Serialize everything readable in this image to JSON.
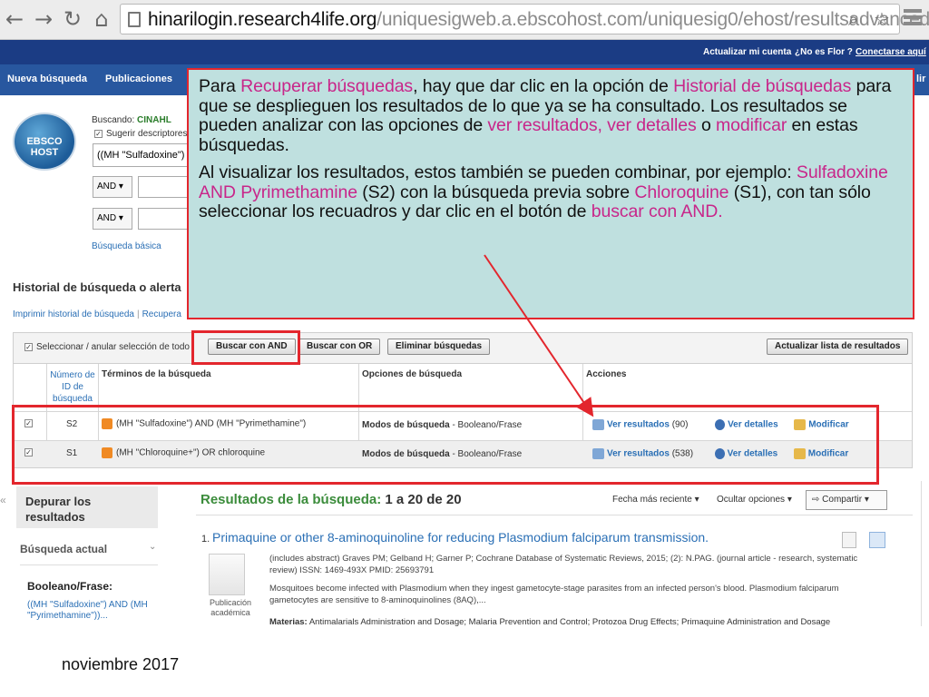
{
  "browser": {
    "url_host": "hinarilogin.research4life.org",
    "url_path": "/uniquesigweb.a.ebscohost.com/uniquesig0/ehost/resultsadvanced?..."
  },
  "topbar": {
    "update_account": "Actualizar mi cuenta",
    "not_user": "¿No es Flor ?",
    "login": "Conectarse aquí",
    "right_edge": "lir"
  },
  "navbar": {
    "new_search": "Nueva búsqueda",
    "publications": "Publicaciones"
  },
  "search": {
    "logo_text": "EBSCO HOST",
    "searching_label": "Buscando:",
    "database": "CINAHL",
    "suggest_label": "Sugerir descriptores",
    "query_value": "((MH \"Sulfadoxine\")",
    "bool_1": "AND",
    "bool_2": "AND",
    "basic_search": "Búsqueda básica"
  },
  "history": {
    "title": "Historial de búsqueda o alerta",
    "print_link": "Imprimir historial de búsqueda",
    "retrieve_link": "Recupera",
    "select_all": "Seleccionar / anular selección de todo",
    "btn_and": "Buscar con AND",
    "btn_or": "Buscar con OR",
    "btn_delete": "Eliminar búsquedas",
    "btn_refresh": "Actualizar lista de resultados",
    "col_id": "Número de ID de búsqueda",
    "col_terms": "Términos de la búsqueda",
    "col_options": "Opciones de búsqueda",
    "col_actions": "Acciones",
    "rows": [
      {
        "id": "S2",
        "terms": "(MH \"Sulfadoxine\") AND (MH \"Pyrimethamine\")",
        "mode_label": "Modos de búsqueda",
        "mode_value": "- Booleano/Frase",
        "view_results": "Ver resultados",
        "count": "(90)",
        "view_details": "Ver detalles",
        "modify": "Modificar"
      },
      {
        "id": "S1",
        "terms": "(MH \"Chloroquine+\") OR chloroquine",
        "mode_label": "Modos de búsqueda",
        "mode_value": "- Booleano/Frase",
        "view_results": "Ver resultados",
        "count": "(538)",
        "view_details": "Ver detalles",
        "modify": "Modificar"
      }
    ]
  },
  "sidebar": {
    "refine": "Depurar los resultados",
    "current_search": "Búsqueda actual",
    "bool_label": "Booleano/Frase:",
    "query": "((MH \"Sulfadoxine\") AND (MH \"Pyrimethamine\"))..."
  },
  "results": {
    "title": "Resultados de la búsqueda:",
    "range": "1 a 20 de 20",
    "sort": "Fecha más reciente",
    "hide_options": "Ocultar opciones",
    "share": "Compartir",
    "article": {
      "number": "1.",
      "title": "Primaquine or other 8-aminoquinoline for reducing Plasmodium falciparum transmission.",
      "meta": "(includes abstract) Graves PM; Gelband H; Garner P; Cochrane Database of Systematic Reviews, 2015; (2): N.PAG. (journal article - research, systematic review) ISSN: 1469-493X PMID: 25693791",
      "abstract": "Mosquitoes become infected with Plasmodium when they ingest gametocyte-stage parasites from an infected person's blood. Plasmodium falciparum gametocytes are sensitive to 8-aminoquinolines (8AQ),...",
      "subjects_label": "Materias:",
      "subjects": "Antimalarials Administration and Dosage; Malaria Prevention and Control; Protozoa Drug Effects; Primaquine Administration and Dosage",
      "pub_type": "Publicación académica"
    }
  },
  "callout": {
    "p1_a": "Para ",
    "p1_b": "Recuperar búsquedas",
    "p1_c": ", hay que dar clic en la opción de ",
    "p1_d": "Historial de búsquedas",
    "p1_e": " para que se desplieguen los resultados de lo que ya se ha consultado. Los resultados se pueden analizar con las opciones de ",
    "p1_f": "ver resultados, ver detalles",
    "p1_g": " o ",
    "p1_h": "modificar",
    "p1_i": " en estas búsquedas.",
    "p2_a": "Al visualizar los resultados, estos también se pueden combinar, por ejemplo: ",
    "p2_b": "Sulfadoxine AND Pyrimethamine",
    "p2_c": " (S2) con la búsqueda previa sobre ",
    "p2_d": "Chloroquine",
    "p2_e": " (S1), con tan sólo seleccionar los recuadros y dar clic en el botón de ",
    "p2_f": "buscar con AND."
  },
  "footer": {
    "date": "noviembre 2017"
  },
  "colors": {
    "accent_red": "#e3262d",
    "callout_bg": "#bfe0df",
    "highlight_pink": "#c8268a",
    "nav_blue": "#28579f"
  }
}
